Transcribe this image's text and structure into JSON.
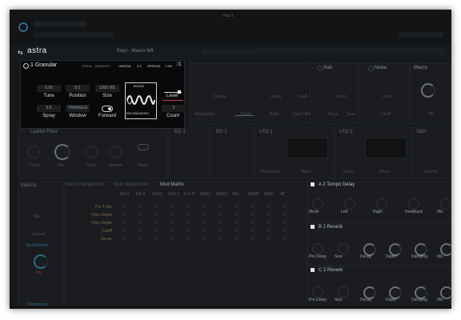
{
  "window": {
    "title": "Vital 1"
  },
  "brand": {
    "name": "astra"
  },
  "preset": {
    "name": "Keys - Macro Wit"
  },
  "granular": {
    "title": "1 Granular",
    "grain_label": "GRAIN",
    "options": [
      "ONESHOT",
      "UNISON",
      "SPREAD"
    ],
    "unison_value": "3.3",
    "spread_value": "7.5%",
    "params": [
      {
        "value": "0.00",
        "label": "Tune"
      },
      {
        "value": "0.0",
        "label": "Position"
      },
      {
        "value": "1000 MS",
        "label": "Size"
      },
      {
        "value": "0.0",
        "label": "Spray"
      },
      {
        "value": "TRIANGLE",
        "label": "Window"
      },
      {
        "value": "",
        "label": "Forward"
      }
    ],
    "wave_label": "800 GRAINS/SEC",
    "wave_top": "BLEND",
    "level_label": "Level",
    "count_value": "2",
    "count_label": "Count"
  },
  "top_modules": {
    "sub_label": "Sub",
    "noise_label": "Noise",
    "macro_label": "Macro"
  },
  "osc_row_labels": [
    "Coarse",
    "Linear",
    "Level",
    "Level",
    "Level"
  ],
  "osc_row2_labels": [
    "Modulation",
    "Depth",
    "Ratio",
    "Rate Filter",
    "Wave",
    "Tune",
    "Cutoff",
    "Tilt"
  ],
  "ladder": {
    "title": "Ladder Filter",
    "labels": [
      "Cutoff",
      "Res",
      "Drive",
      "Spread",
      "Mode"
    ]
  },
  "eg_titles": [
    "EG 1",
    "EG 2"
  ],
  "lfo1": {
    "title": "LFO 1",
    "labels": [
      "Frequency",
      "Wave"
    ]
  },
  "lfo2": {
    "title": "LFO 2",
    "labels": [
      "Tempo",
      "Wave"
    ]
  },
  "sh": {
    "title": "S&H",
    "labels": [
      "Smooth"
    ]
  },
  "macros": {
    "title": "Macros",
    "items": [
      "Wet",
      "Spread",
      "SpreadDrive",
      "Dry",
      "Simpletone"
    ]
  },
  "mod_tabs": [
    "Macro Sequencer",
    "Note Sequencer",
    "Mod Matrix"
  ],
  "mod_matrix": {
    "columns": [
      "EG 1",
      "EG 2",
      "LFO1",
      "LFO 2",
      "S & H",
      "MAC1",
      "MAC2",
      "VEL",
      "RAND",
      "MOD",
      "AT"
    ],
    "rows": [
      "Pre 1 Mix",
      "Filter Depth",
      "Filter Depth",
      "Cutoff",
      "Decay"
    ]
  },
  "effects": [
    {
      "title": "A 2 Tempo Delay",
      "labels": [
        "Mode",
        "Left",
        "Right",
        "Feedback",
        "Mix"
      ]
    },
    {
      "title": "B 2 Reverb",
      "labels": [
        "Pre Delay",
        "Size",
        "Decay",
        "Depth",
        "Damping",
        "Mix"
      ]
    },
    {
      "title": "C 2 Reverb",
      "labels": [
        "Pre Delay",
        "Size",
        "Decay",
        "Depth",
        "Damping",
        "Mix"
      ]
    }
  ]
}
